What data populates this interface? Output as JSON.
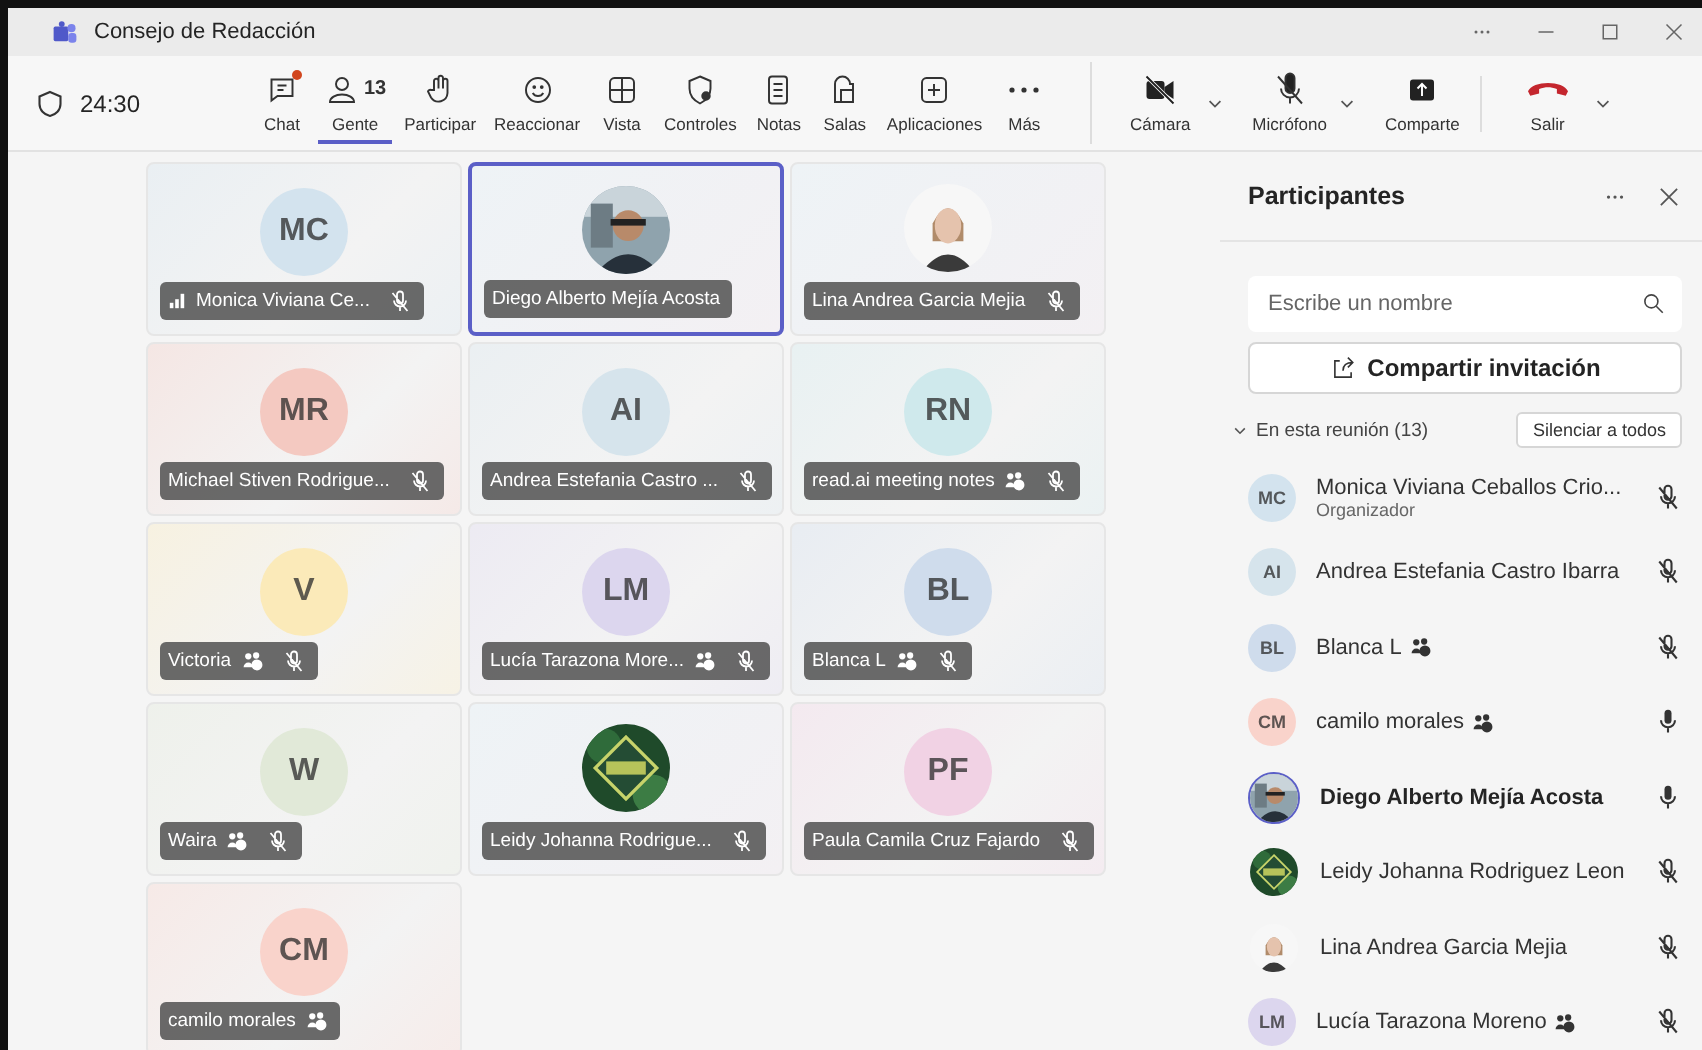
{
  "window": {
    "title": "Consejo de Redacción"
  },
  "toolbar": {
    "timer": "24:30",
    "items": [
      {
        "label": "Chat",
        "selected": false,
        "notification": true
      },
      {
        "label": "Gente",
        "badge": "13",
        "selected": true,
        "notification": false
      },
      {
        "label": "Participar",
        "selected": false,
        "notification": false
      },
      {
        "label": "Reaccionar",
        "selected": false,
        "notification": false
      },
      {
        "label": "Vista",
        "selected": false,
        "notification": false
      },
      {
        "label": "Controles",
        "selected": false,
        "notification": false
      },
      {
        "label": "Notas",
        "selected": false,
        "notification": false
      },
      {
        "label": "Salas",
        "selected": false,
        "notification": false
      },
      {
        "label": "Aplicaciones",
        "selected": false,
        "notification": false
      },
      {
        "label": "Más",
        "selected": false,
        "notification": false
      }
    ],
    "devices": [
      {
        "label": "Cámara",
        "dropdown": true
      },
      {
        "label": "Micrófono",
        "dropdown": true
      },
      {
        "label": "Comparte",
        "dropdown": false
      },
      {
        "label": "Salir",
        "dropdown": true
      }
    ]
  },
  "tiles": [
    {
      "kind": "initials",
      "initials": "MC",
      "color": "#d3e3ee",
      "name": "Monica Viviana Ce...",
      "signal": true,
      "guest": false,
      "muted": true,
      "selected": false
    },
    {
      "name": "Diego Alberto Mejía Acosta",
      "signal": false,
      "guest": false,
      "muted": false,
      "selected": true
    },
    {
      "name": "Lina Andrea Garcia Mejia",
      "signal": false,
      "guest": false,
      "muted": true,
      "selected": false
    },
    {
      "kind": "initials",
      "initials": "MR",
      "color": "#f4c9c1",
      "name": "Michael Stiven Rodrigue...",
      "signal": false,
      "guest": false,
      "muted": true,
      "selected": false
    },
    {
      "kind": "initials",
      "initials": "AI",
      "color": "#d6e4ec",
      "name": "Andrea Estefania Castro ...",
      "signal": false,
      "guest": false,
      "muted": true,
      "selected": false
    },
    {
      "kind": "initials",
      "initials": "RN",
      "color": "#cfe9ec",
      "name": "read.ai meeting notes",
      "signal": false,
      "guest": true,
      "muted": true,
      "selected": false
    },
    {
      "kind": "initials",
      "initials": "V",
      "color": "#fbeab9",
      "name": "Victoria",
      "signal": false,
      "guest": true,
      "muted": true,
      "selected": false
    },
    {
      "kind": "initials",
      "initials": "LM",
      "color": "#dcd6ee",
      "name": "Lucía Tarazona More...",
      "signal": false,
      "guest": true,
      "muted": true,
      "selected": false
    },
    {
      "kind": "initials",
      "initials": "BL",
      "color": "#cfdcec",
      "name": "Blanca L",
      "signal": false,
      "guest": true,
      "muted": true,
      "selected": false
    },
    {
      "kind": "initials",
      "initials": "W",
      "color": "#e1e9d8",
      "name": "Waira",
      "signal": false,
      "guest": true,
      "muted": true,
      "selected": false
    },
    {
      "name": "Leidy Johanna Rodrigue...",
      "signal": false,
      "guest": false,
      "muted": true,
      "selected": false
    },
    {
      "kind": "initials",
      "initials": "PF",
      "color": "#f1d2e4",
      "name": "Paula Camila Cruz Fajardo",
      "signal": false,
      "guest": false,
      "muted": true,
      "selected": false
    },
    {
      "kind": "initials",
      "initials": "CM",
      "color": "#f9d3cb",
      "name": "camilo morales",
      "signal": false,
      "guest": true,
      "muted": false,
      "selected": false
    }
  ],
  "panel": {
    "title": "Participantes",
    "search": {
      "placeholder": "Escribe un nombre"
    },
    "invite_button": "Compartir invitación",
    "section": {
      "label": "En esta reunión (13)",
      "expanded": true
    },
    "mute_all_button": "Silenciar a todos",
    "participants": [
      {
        "kind": "initials",
        "initials": "MC",
        "color": "#d3e3ee",
        "name": "Monica Viviana Ceballos Crio...",
        "role": "Organizador",
        "guest": false,
        "muted": true,
        "speaking": false
      },
      {
        "kind": "initials",
        "initials": "AI",
        "color": "#d6e4ec",
        "name": "Andrea Estefania Castro Ibarra",
        "guest": false,
        "muted": true,
        "speaking": false
      },
      {
        "kind": "initials",
        "initials": "BL",
        "color": "#cfdcec",
        "name": "Blanca L",
        "guest": true,
        "muted": true,
        "speaking": false
      },
      {
        "kind": "initials",
        "initials": "CM",
        "color": "#f9d3cb",
        "name": "camilo morales",
        "guest": true,
        "muted": false,
        "speaking": false
      },
      {
        "name": "Diego Alberto Mejía Acosta",
        "guest": false,
        "muted": false,
        "speaking": true
      },
      {
        "name": "Leidy Johanna Rodriguez Leon",
        "guest": false,
        "muted": true,
        "speaking": false
      },
      {
        "name": "Lina Andrea Garcia Mejia",
        "guest": false,
        "muted": true,
        "speaking": false
      },
      {
        "kind": "initials",
        "initials": "LM",
        "color": "#dcd6ee",
        "name": "Lucía Tarazona Moreno",
        "guest": true,
        "muted": true,
        "speaking": false
      }
    ]
  }
}
